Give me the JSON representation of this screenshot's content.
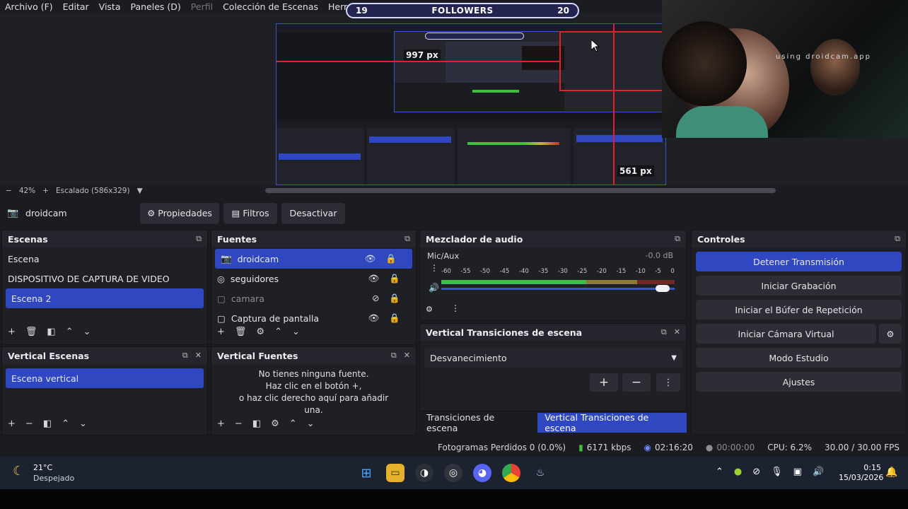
{
  "menu": {
    "items": [
      "Archivo (F)",
      "Editar",
      "Vista",
      "Paneles (D)",
      "Perfil",
      "Colección de Escenas",
      "Herramientas"
    ]
  },
  "overlay": {
    "followers_left": "19",
    "followers_label": "FOLLOWERS",
    "followers_right": "20",
    "camera_text": "using droidcam.app",
    "width_label": "997 px",
    "height_label": "561 px"
  },
  "preview": {
    "zoom": "42%",
    "scale_label": "Escalado (586x329)"
  },
  "source_toolbar": {
    "source_name": "droidcam",
    "properties_label": "Propiedades",
    "filters_label": "Filtros",
    "deactivate_label": "Desactivar"
  },
  "scenes": {
    "title": "Escenas",
    "items": [
      "Escena",
      "DISPOSITIVO DE CAPTURA DE VIDEO",
      "Escena 2"
    ],
    "selected": "Escena 2"
  },
  "sources": {
    "title": "Fuentes",
    "items": [
      {
        "label": "droidcam",
        "icon": "camera-icon",
        "visible": true
      },
      {
        "label": "seguidores",
        "icon": "globe-icon",
        "visible": true
      },
      {
        "label": "camara",
        "icon": "monitor-icon",
        "visible": false
      },
      {
        "label": "Captura de pantalla",
        "icon": "monitor-icon",
        "visible": true
      }
    ]
  },
  "mixer": {
    "title": "Mezclador de audio",
    "channel": "Mic/Aux",
    "db": "-0.0 dB",
    "scale": [
      "-60",
      "-55",
      "-50",
      "-45",
      "-40",
      "-35",
      "-30",
      "-25",
      "-20",
      "-15",
      "-10",
      "-5",
      "0"
    ],
    "volume": 0.98
  },
  "controls": {
    "title": "Controles",
    "buttons": [
      "Detener Transmisión",
      "Iniciar Grabación",
      "Iniciar el Búfer de Repetición",
      "Iniciar Cámara Virtual",
      "Modo Estudio",
      "Ajustes"
    ]
  },
  "vscenes": {
    "title": "Vertical Escenas",
    "items": [
      "Escena vertical"
    ]
  },
  "vsources": {
    "title": "Vertical Fuentes",
    "empty_line1": "No tienes ninguna fuente.",
    "empty_line2": "Haz clic en el botón +,",
    "empty_line3": "o haz clic derecho aquí para añadir",
    "empty_line4": "una."
  },
  "vtrans": {
    "title": "Vertical Transiciones de escena",
    "selected": "Desvanecimiento",
    "tab1": "Transiciones de escena",
    "tab2": "Vertical Transiciones de escena"
  },
  "status": {
    "dropped": "Fotogramas Perdidos 0 (0.0%)",
    "bitrate": "6171 kbps",
    "stream_time": "02:16:20",
    "rec_time": "00:00:00",
    "cpu": "CPU: 6.2%",
    "fps": "30.00 / 30.00 FPS"
  },
  "taskbar": {
    "temp": "21°C",
    "weather": "Despejado",
    "time": "0:15",
    "date": "15/03/2026"
  },
  "colors": {
    "accent": "#2f47c0",
    "meter_green": "#3fbf3f",
    "meter_yellow": "#c9b43a",
    "meter_red": "#c0392b",
    "guide_red": "#e3202b"
  }
}
